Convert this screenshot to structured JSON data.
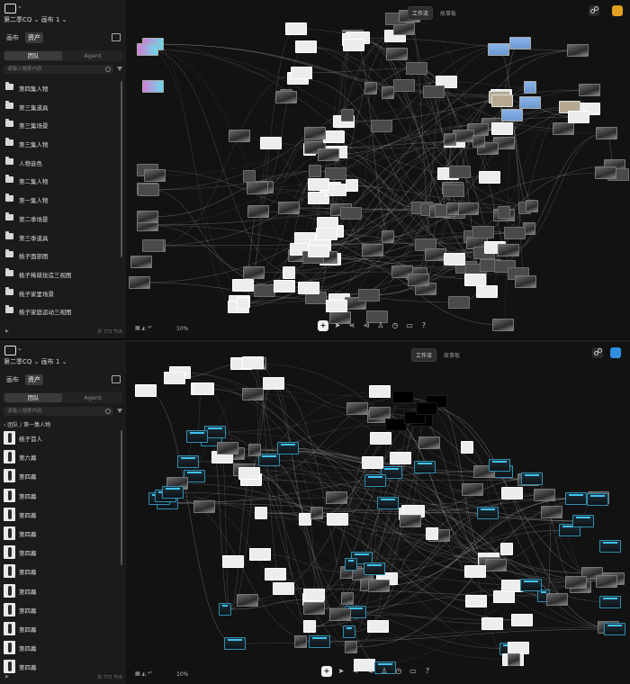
{
  "top": {
    "project_breadcrumb": "第二季CQ ⌄ 画布 1 ⌄",
    "tab_canvas": "画布",
    "tab_assets": "资产",
    "segment_team": "团队",
    "segment_agent": "Agent",
    "search_placeholder": "请输入搜索内容",
    "folders": [
      "第四集人物",
      "第三集道具",
      "第三集场景",
      "第三集人物",
      "人物音色",
      "第二集人物",
      "第一集人物",
      "第二季场景",
      "第三季道具",
      "桃子面部图",
      "桃子稀疏妆造三视图",
      "桃子家里场景",
      "桃子家庭运动三视图"
    ],
    "footer_count": "共 772 节点",
    "pill_workflow": "工作流",
    "pill_storyboard": "故事板",
    "zoom": "10%"
  },
  "bottom": {
    "project_breadcrumb": "第二季CQ ⌄ 画布 1 ⌄",
    "tab_canvas": "画布",
    "tab_assets": "资产",
    "segment_team": "团队",
    "segment_agent": "Agent",
    "search_placeholder": "请输入搜索内容",
    "sub_breadcrumb": "‹  团队  /  第一集人物",
    "assets": [
      "桃子首人",
      "第六幕",
      "第四幕",
      "第四幕",
      "第四幕",
      "第四幕",
      "第四幕",
      "第四幕",
      "第四幕",
      "第四幕",
      "第四幕",
      "第四幕",
      "第四幕"
    ],
    "footer_count": "共 772 节点",
    "pill_workflow": "工作流",
    "pill_storyboard": "故事板",
    "zoom": "10%"
  },
  "colors": {
    "background": "#121213",
    "sidebar": "#1b1b1d",
    "accent_cyan": "#3fc3ef",
    "account_yellow": "#e0a020",
    "account_blue": "#2f8fe0"
  },
  "icons": [
    "logo-icon",
    "book-icon",
    "search-icon",
    "filter-icon",
    "folder-icon",
    "plus-icon",
    "pointer-icon",
    "share-icon",
    "arrow-icon",
    "person-icon",
    "clock-icon",
    "grid-icon",
    "help-icon"
  ]
}
